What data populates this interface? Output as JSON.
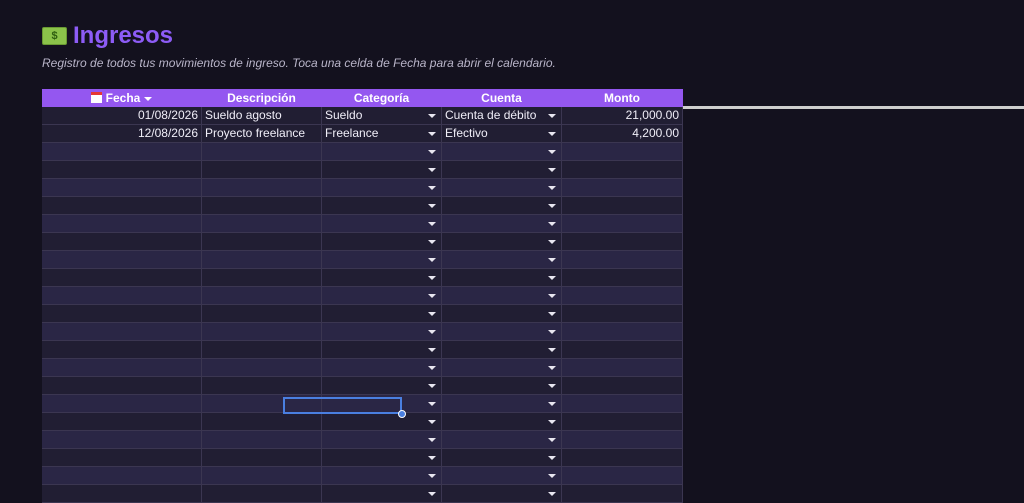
{
  "header": {
    "icon": "money-icon",
    "title": "Ingresos",
    "subtitle": "Registro de todos tus movimientos de ingreso. Toca una celda de Fecha para abrir el calendario."
  },
  "table": {
    "columns": [
      "Fecha",
      "Descripción",
      "Categoría",
      "Cuenta",
      "Monto"
    ],
    "rows": [
      {
        "fecha": "01/08/2026",
        "descripcion": "Sueldo agosto",
        "categoria": "Sueldo",
        "cuenta": "Cuenta de débito",
        "monto": "21,000.00"
      },
      {
        "fecha": "12/08/2026",
        "descripcion": "Proyecto freelance",
        "categoria": "Freelance",
        "cuenta": "Efectivo",
        "monto": "4,200.00"
      }
    ],
    "empty_row_count": 20
  },
  "colors": {
    "accent": "#8d5cf6",
    "header_bg": "#9457f0",
    "selection": "#4a7fe0",
    "background": "#13111e"
  }
}
